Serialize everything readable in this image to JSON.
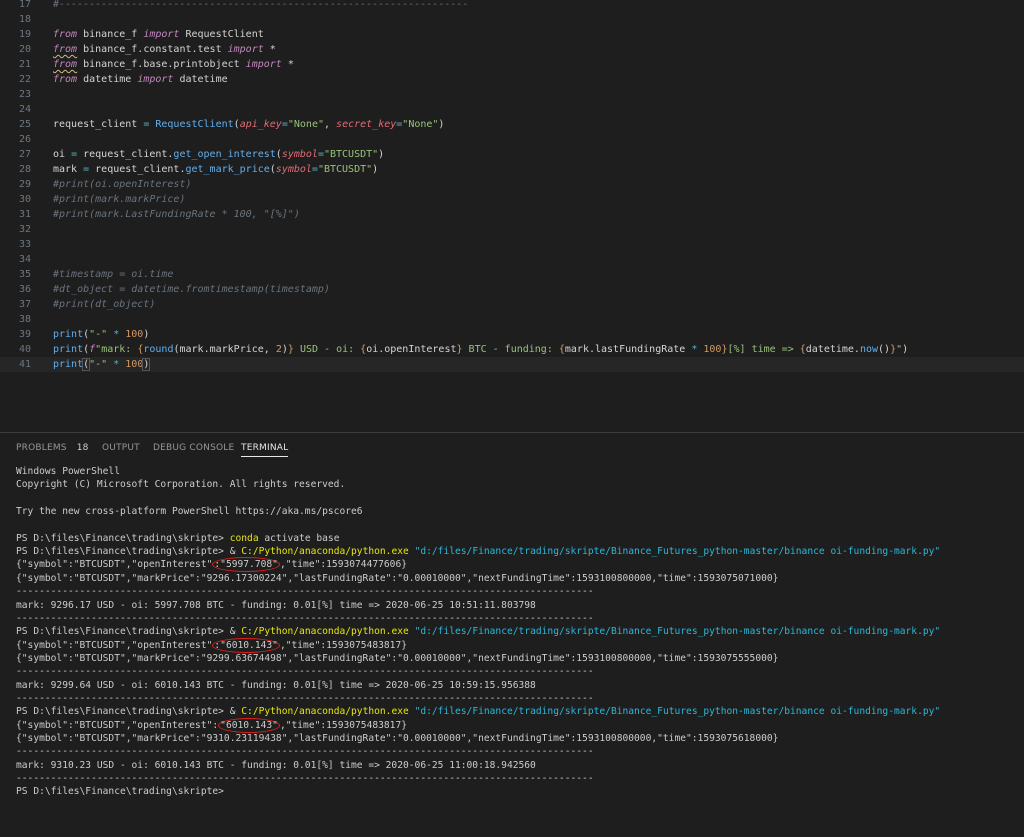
{
  "editor": {
    "lines": [
      {
        "n": "17",
        "kind": "divider",
        "text": "#--------------------------------------------------------------------"
      },
      {
        "n": "18",
        "kind": "blank"
      },
      {
        "n": "19",
        "kind": "import",
        "kw1": "from",
        "mod": " binance_f ",
        "kw2": "import",
        "rest": " RequestClient",
        "squig": false
      },
      {
        "n": "20",
        "kind": "import",
        "kw1": "from",
        "mod": " binance_f.constant.test ",
        "kw2": "import",
        "rest": " *",
        "squig": true
      },
      {
        "n": "21",
        "kind": "import",
        "kw1": "from",
        "mod": " binance_f.base.printobject ",
        "kw2": "import",
        "rest": " *",
        "squig": true
      },
      {
        "n": "22",
        "kind": "import",
        "kw1": "from",
        "mod": " datetime ",
        "kw2": "import",
        "rest": " datetime",
        "squig": false
      },
      {
        "n": "23",
        "kind": "blank"
      },
      {
        "n": "24",
        "kind": "blank"
      },
      {
        "n": "25",
        "kind": "client",
        "a": "request_client ",
        "eq": "=",
        "b": " ",
        "fn": "RequestClient",
        "p1": "(",
        "k1": "api_key",
        "e1": "=",
        "v1": "\"None\"",
        "c": ", ",
        "k2": "secret_key",
        "e2": "=",
        "v2": "\"None\"",
        "p2": ")"
      },
      {
        "n": "26",
        "kind": "blank"
      },
      {
        "n": "27",
        "kind": "call",
        "a": "oi ",
        "eq": "=",
        "b": " request_client.",
        "fn": "get_open_interest",
        "p1": "(",
        "k": "symbol",
        "e": "=",
        "v": "\"BTCUSDT\"",
        "p2": ")"
      },
      {
        "n": "28",
        "kind": "call",
        "a": "mark ",
        "eq": "=",
        "b": " request_client.",
        "fn": "get_mark_price",
        "p1": "(",
        "k": "symbol",
        "e": "=",
        "v": "\"BTCUSDT\"",
        "p2": ")"
      },
      {
        "n": "29",
        "kind": "comment",
        "text": "#print(oi.openInterest)"
      },
      {
        "n": "30",
        "kind": "comment",
        "text": "#print(mark.markPrice)"
      },
      {
        "n": "31",
        "kind": "comment",
        "text": "#print(mark.LastFundingRate * 100, \"[%]\")"
      },
      {
        "n": "32",
        "kind": "blank"
      },
      {
        "n": "33",
        "kind": "blank"
      },
      {
        "n": "34",
        "kind": "blank"
      },
      {
        "n": "35",
        "kind": "comment",
        "text": "#timestamp = oi.time"
      },
      {
        "n": "36",
        "kind": "comment",
        "text": "#dt_object = datetime.fromtimestamp(timestamp)"
      },
      {
        "n": "37",
        "kind": "comment",
        "text": "#print(dt_object)"
      },
      {
        "n": "38",
        "kind": "blank"
      },
      {
        "n": "39",
        "kind": "printdash",
        "fn": "print",
        "p1": "(",
        "s": "\"-\"",
        "op": " * ",
        "num": "100",
        "p2": ")"
      },
      {
        "n": "40",
        "kind": "printf"
      },
      {
        "n": "41",
        "kind": "printdash",
        "fn": "print",
        "p1": "(",
        "s": "\"-\" ",
        "op": "* ",
        "num": "100",
        "p2": ")",
        "active": true
      }
    ],
    "line40": {
      "fn": "print",
      "p1": "(",
      "pref": "f",
      "s1": "\"mark: ",
      "o1": "{",
      "fn2": "round",
      "r1": "(mark.markPrice, ",
      "n1": "2",
      "r2": ")",
      "c1": "}",
      "s2": " USD - oi: ",
      "o2": "{",
      "v2": "oi.openInterest",
      "c2": "}",
      "s3": " BTC - funding: ",
      "o3": "{",
      "v3": "mark.lastFundingRate ",
      "op": "*",
      "n3": " 100",
      "c3": "}",
      "s4": "[%] time => ",
      "o4": "{",
      "v4": "datetime.",
      "fn3": "now",
      "v5": "()",
      "c4": "}",
      "s5": "\"",
      "p2": ")"
    }
  },
  "panel": {
    "tabs": [
      {
        "label": "PROBLEMS",
        "badge": "18"
      },
      {
        "label": "OUTPUT"
      },
      {
        "label": "DEBUG CONSOLE"
      },
      {
        "label": "TERMINAL",
        "active": true
      }
    ],
    "terminal": [
      {
        "t": "Windows PowerShell"
      },
      {
        "t": "Copyright (C) Microsoft Corporation. All rights reserved."
      },
      {
        "t": ""
      },
      {
        "t": "Try the new cross-platform PowerShell https://aka.ms/pscore6"
      },
      {
        "t": ""
      },
      {
        "kind": "conda",
        "prompt": "PS D:\\files\\Finance\\trading\\skripte> ",
        "cmd": "conda",
        "rest": " activate base"
      },
      {
        "kind": "run",
        "prompt": "PS D:\\files\\Finance\\trading\\skripte> ",
        "amp": "& ",
        "exe": "C:/Python/anaconda/python.exe",
        "arg": " \"d:/files/Finance/trading/skripte/Binance_Futures_python-master/binance oi-funding-mark.py\""
      },
      {
        "kind": "oi",
        "pre": "{\"symbol\":\"BTCUSDT\",\"openInterest\"",
        "circ": ":\"5997.708\"",
        "post": ",\"time\":1593074477606}"
      },
      {
        "t": "{\"symbol\":\"BTCUSDT\",\"markPrice\":\"9296.17300224\",\"lastFundingRate\":\"0.00010000\",\"nextFundingTime\":1593100800000,\"time\":1593075071000}"
      },
      {
        "t": "----------------------------------------------------------------------------------------------------"
      },
      {
        "t": "mark: 9296.17 USD - oi: 5997.708 BTC - funding: 0.01[%] time => 2020-06-25 10:51:11.803798"
      },
      {
        "t": "----------------------------------------------------------------------------------------------------"
      },
      {
        "kind": "run",
        "prompt": "PS D:\\files\\Finance\\trading\\skripte> ",
        "amp": "& ",
        "exe": "C:/Python/anaconda/python.exe",
        "arg": " \"d:/files/Finance/trading/skripte/Binance_Futures_python-master/binance oi-funding-mark.py\""
      },
      {
        "kind": "oi",
        "pre": "{\"symbol\":\"BTCUSDT\",\"openInterest\"",
        "circ": ":\"6010.143\"",
        "post": ",\"time\":1593075483817}"
      },
      {
        "t": "{\"symbol\":\"BTCUSDT\",\"markPrice\":\"9299.63674498\",\"lastFundingRate\":\"0.00010000\",\"nextFundingTime\":1593100800000,\"time\":1593075555000}"
      },
      {
        "t": "----------------------------------------------------------------------------------------------------"
      },
      {
        "t": "mark: 9299.64 USD - oi: 6010.143 BTC - funding: 0.01[%] time => 2020-06-25 10:59:15.956388"
      },
      {
        "t": "----------------------------------------------------------------------------------------------------"
      },
      {
        "kind": "run",
        "prompt": "PS D:\\files\\Finance\\trading\\skripte> ",
        "amp": "& ",
        "exe": "C:/Python/anaconda/python.exe",
        "arg": " \"d:/files/Finance/trading/skripte/Binance_Futures_python-master/binance oi-funding-mark.py\""
      },
      {
        "kind": "oi",
        "pre": "{\"symbol\":\"BTCUSDT\",\"openInterest\":",
        "circ": "\"6010.143\"",
        "post": ",\"time\":1593075483817}"
      },
      {
        "t": "{\"symbol\":\"BTCUSDT\",\"markPrice\":\"9310.23119438\",\"lastFundingRate\":\"0.00010000\",\"nextFundingTime\":1593100800000,\"time\":1593075618000}"
      },
      {
        "t": "----------------------------------------------------------------------------------------------------"
      },
      {
        "t": "mark: 9310.23 USD - oi: 6010.143 BTC - funding: 0.01[%] time => 2020-06-25 11:00:18.942560"
      },
      {
        "t": "----------------------------------------------------------------------------------------------------"
      },
      {
        "t": "PS D:\\files\\Finance\\trading\\skripte>"
      }
    ]
  },
  "colors": {
    "annotation": "#e0201a"
  }
}
